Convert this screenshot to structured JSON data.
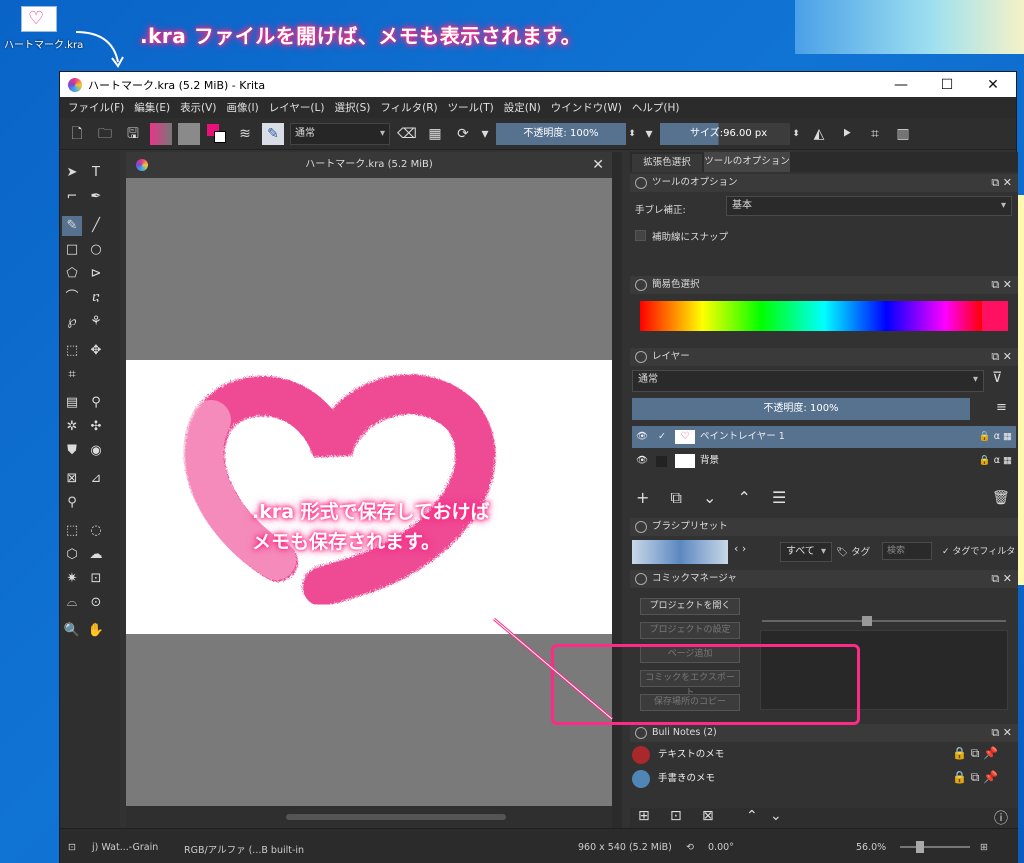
{
  "desktop": {
    "icon_label": "ハートマーク.kra",
    "headline": ".kra ファイルを開けば、メモも表示されます。"
  },
  "window": {
    "title": "ハートマーク.kra (5.2 MiB)  - Krita",
    "min_icon": "minimize-icon",
    "max_icon": "maximize-icon",
    "close_icon": "close-icon"
  },
  "menu": [
    "ファイル(F)",
    "編集(E)",
    "表示(V)",
    "画像(I)",
    "レイヤー(L)",
    "選択(S)",
    "フィルタ(R)",
    "ツール(T)",
    "設定(N)",
    "ウインドウ(W)",
    "ヘルプ(H)"
  ],
  "toolbar": {
    "blend_mode": "通常",
    "opacity": "不透明度: 100%",
    "size_label": "サイズ:",
    "size_value": "96.00 px"
  },
  "document": {
    "tab_title": "ハートマーク.kra (5.2 MiB)"
  },
  "docker_tabs": [
    "拡張色選択",
    "ツールのオプション"
  ],
  "tool_options": {
    "header": "ツールのオプション",
    "stabilizer_label": "手ブレ補正:",
    "stabilizer_value": "基本",
    "snap_label": "補助線にスナップ"
  },
  "color_selector": {
    "header": "簡易色選択"
  },
  "layers": {
    "header": "レイヤー",
    "blend_mode": "通常",
    "opacity": "不透明度:  100%",
    "items": [
      {
        "name": "ペイントレイヤー 1",
        "selected": true
      },
      {
        "name": "背景",
        "selected": false
      }
    ]
  },
  "brush_presets": {
    "header": "ブラシプリセット",
    "filter_value": "すべて",
    "tag_label": "タグ",
    "search_placeholder": "検索",
    "filter_by_tag": "タグでフィルタ"
  },
  "comic_manager": {
    "header": "コミックマネージャ",
    "buttons": [
      "プロジェクトを開く",
      "プロジェクトの設定",
      "ページ追加",
      "コミックをエクスポート",
      "保存場所のコピー"
    ]
  },
  "buli_notes": {
    "header": "Buli Notes (2)",
    "notes": [
      {
        "title": "テキストのメモ",
        "color": "#a8282c"
      },
      {
        "title": "手書きのメモ",
        "color": "#4f86b6"
      }
    ]
  },
  "annotation": {
    "line1": ".kra 形式で保存しておけば",
    "line2": "メモも保存されます。"
  },
  "status": {
    "brush": "j) Wat...-Grain",
    "colorspace": "RGB/アルファ (...B built-in",
    "dimensions": "960 x 540 (5.2 MiB)",
    "rotation": "0.00°",
    "zoom": "56.0%"
  },
  "colors": {
    "accent": "#ff2a86",
    "slider": "#56728f",
    "heart": "#ee3a8c"
  }
}
